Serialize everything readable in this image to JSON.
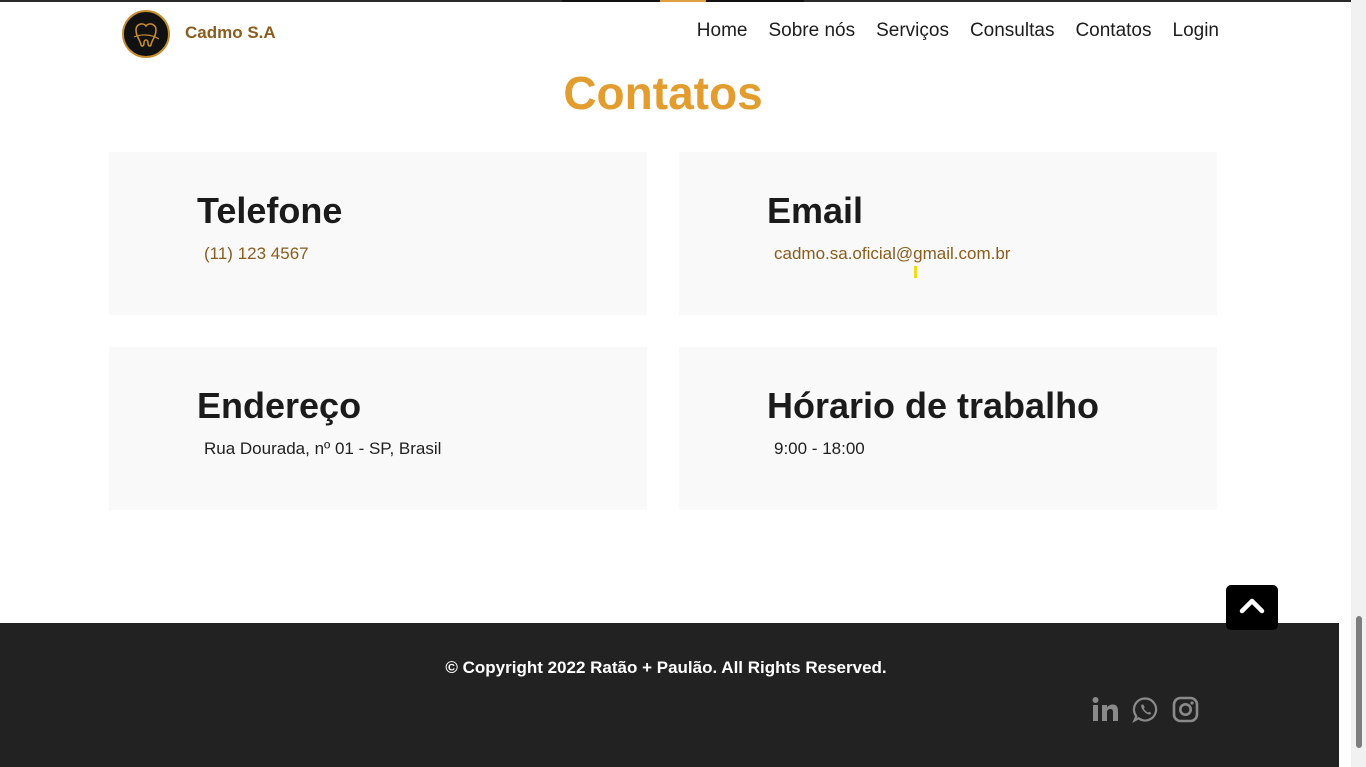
{
  "header": {
    "brand": "Cadmo S.A",
    "nav": [
      "Home",
      "Sobre nós",
      "Serviços",
      "Consultas",
      "Contatos",
      "Login"
    ]
  },
  "section": {
    "title": "Contatos"
  },
  "cards": [
    {
      "title": "Telefone",
      "value": "(11) 123 4567"
    },
    {
      "title": "Email",
      "value": "cadmo.sa.oficial@gmail.com.br"
    },
    {
      "title": "Endereço",
      "value": "Rua Dourada, nº 01 - SP, Brasil"
    },
    {
      "title": "Hórario de trabalho",
      "value": "9:00 - 18:00"
    }
  ],
  "footer": {
    "copyright": "© Copyright 2022 Ratão + Paulão. All Rights Reserved.",
    "social": [
      "linkedin-icon",
      "whatsapp-icon",
      "instagram-icon"
    ]
  },
  "colors": {
    "accent": "#e39d2f",
    "brand": "#8a5d1e",
    "footer_bg": "#222222",
    "card_bg": "#f9f9f9"
  }
}
